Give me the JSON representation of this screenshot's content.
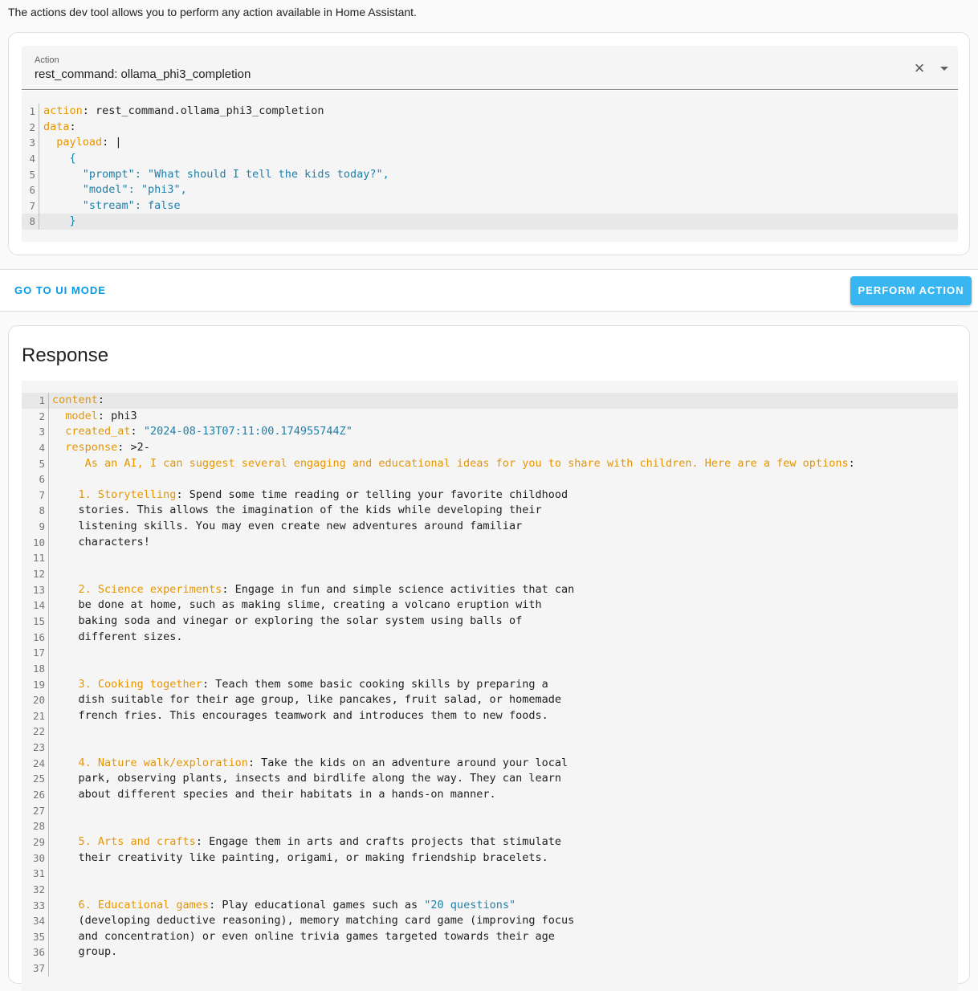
{
  "intro": "The actions dev tool allows you to perform any action available in Home Assistant.",
  "action_field": {
    "label": "Action",
    "value": "rest_command: ollama_phi3_completion",
    "clear_icon": "close-icon",
    "dropdown_icon": "chevron-down-icon"
  },
  "action_editor": {
    "active_line": 8,
    "lines": [
      [
        [
          "k",
          "action"
        ],
        [
          "t",
          ": rest_command.ollama_phi3_completion"
        ]
      ],
      [
        [
          "k",
          "data"
        ],
        [
          "t",
          ":"
        ]
      ],
      [
        [
          "t",
          "  "
        ],
        [
          "k",
          "payload"
        ],
        [
          "t",
          ": |"
        ]
      ],
      [
        [
          "s",
          "    {"
        ]
      ],
      [
        [
          "s",
          "      \"prompt\": \"What should I tell the kids today?\","
        ]
      ],
      [
        [
          "s",
          "      \"model\": \"phi3\","
        ]
      ],
      [
        [
          "s",
          "      \"stream\": false"
        ]
      ],
      [
        [
          "s",
          "    }"
        ]
      ]
    ]
  },
  "buttons": {
    "ui_mode": "GO TO UI MODE",
    "perform": "PERFORM ACTION"
  },
  "response": {
    "title": "Response",
    "active_line": 1,
    "lines": [
      [
        [
          "k",
          "content"
        ],
        [
          "t",
          ":"
        ]
      ],
      [
        [
          "t",
          "  "
        ],
        [
          "k",
          "model"
        ],
        [
          "t",
          ": phi3"
        ]
      ],
      [
        [
          "t",
          "  "
        ],
        [
          "k",
          "created_at"
        ],
        [
          "t",
          ": "
        ],
        [
          "s",
          "\"2024-08-13T07:11:00.174955744Z\""
        ]
      ],
      [
        [
          "t",
          "  "
        ],
        [
          "k",
          "response"
        ],
        [
          "t",
          ": >2-"
        ]
      ],
      [
        [
          "h",
          "     As an AI, I can suggest several engaging and educational ideas for you to share with children. Here are a few options"
        ],
        [
          "t",
          ":"
        ]
      ],
      [],
      [
        [
          "h",
          "    1. Storytelling"
        ],
        [
          "t",
          ": Spend some time reading or telling your favorite childhood"
        ]
      ],
      [
        [
          "t",
          "    stories. This allows the imagination of the kids while developing their"
        ]
      ],
      [
        [
          "t",
          "    listening skills. You may even create new adventures around familiar"
        ]
      ],
      [
        [
          "t",
          "    characters!"
        ]
      ],
      [],
      [],
      [
        [
          "h",
          "    2. Science experiments"
        ],
        [
          "t",
          ": Engage in fun and simple science activities that can"
        ]
      ],
      [
        [
          "t",
          "    be done at home, such as making slime, creating a volcano eruption with"
        ]
      ],
      [
        [
          "t",
          "    baking soda and vinegar or exploring the solar system using balls of"
        ]
      ],
      [
        [
          "t",
          "    different sizes."
        ]
      ],
      [],
      [],
      [
        [
          "h",
          "    3. Cooking together"
        ],
        [
          "t",
          ": Teach them some basic cooking skills by preparing a"
        ]
      ],
      [
        [
          "t",
          "    dish suitable for their age group, like pancakes, fruit salad, or homemade"
        ]
      ],
      [
        [
          "t",
          "    french fries. This encourages teamwork and introduces them to new foods."
        ]
      ],
      [],
      [],
      [
        [
          "h",
          "    4. Nature walk/exploration"
        ],
        [
          "t",
          ": Take the kids on an adventure around your local"
        ]
      ],
      [
        [
          "t",
          "    park, observing plants, insects and birdlife along the way. They can learn"
        ]
      ],
      [
        [
          "t",
          "    about different species and their habitats in a hands-on manner."
        ]
      ],
      [],
      [],
      [
        [
          "h",
          "    5. Arts and crafts"
        ],
        [
          "t",
          ": Engage them in arts and crafts projects that stimulate"
        ]
      ],
      [
        [
          "t",
          "    their creativity like painting, origami, or making friendship bracelets."
        ]
      ],
      [],
      [],
      [
        [
          "h",
          "    6. Educational games"
        ],
        [
          "t",
          ": Play educational games such as "
        ],
        [
          "s",
          "\"20 questions\""
        ]
      ],
      [
        [
          "t",
          "    (developing deductive reasoning), memory matching card game (improving focus"
        ]
      ],
      [
        [
          "t",
          "    and concentration) or even online trivia games targeted towards their age"
        ]
      ],
      [
        [
          "t",
          "    group."
        ]
      ],
      []
    ]
  }
}
